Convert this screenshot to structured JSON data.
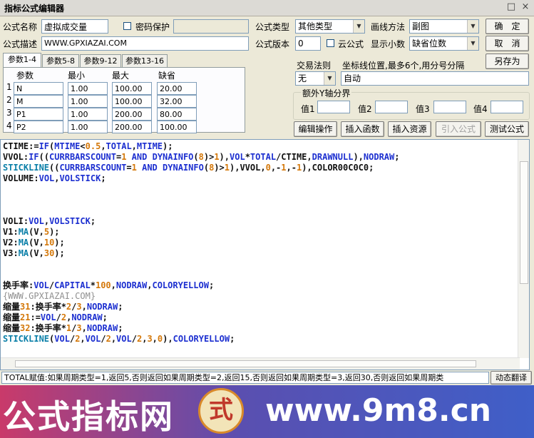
{
  "window": {
    "title": "指标公式编辑器",
    "close_glyph": "×",
    "restore_glyph": "□"
  },
  "form": {
    "name_label": "公式名称",
    "name_value": "虚拟成交量",
    "password_label": "密码保护",
    "desc_label": "公式描述",
    "desc_value": "WWW.GPXIAZAI.COM",
    "type_label": "公式类型",
    "type_value": "其他类型",
    "draw_label": "画线方法",
    "draw_value": "副图",
    "version_label": "公式版本",
    "version_value": "0",
    "cloud_label": "云公式",
    "decimal_label": "显示小数",
    "decimal_value": "缺省位数"
  },
  "buttons": {
    "ok": "确　定",
    "cancel": "取　消",
    "save_as": "另存为",
    "edit_ops": "编辑操作",
    "insert_fn": "插入函数",
    "insert_res": "插入资源",
    "import": "引入公式",
    "test": "测试公式",
    "dyn_translate": "动态翻译"
  },
  "tabs": [
    "参数1-4",
    "参数5-8",
    "参数9-12",
    "参数13-16"
  ],
  "params": {
    "headers": [
      "参数",
      "最小",
      "最大",
      "缺省"
    ],
    "rows": [
      {
        "idx": "1",
        "name": "N",
        "min": "1.00",
        "max": "100.00",
        "def": "20.00"
      },
      {
        "idx": "2",
        "name": "M",
        "min": "1.00",
        "max": "100.00",
        "def": "32.00"
      },
      {
        "idx": "3",
        "name": "P1",
        "min": "1.00",
        "max": "200.00",
        "def": "80.00"
      },
      {
        "idx": "4",
        "name": "P2",
        "min": "1.00",
        "max": "200.00",
        "def": "100.00"
      }
    ]
  },
  "trade": {
    "rule_label": "交易法则",
    "rule_value": "无",
    "axis_label": "坐标线位置,最多6个,用分号分隔",
    "axis_value": "自动"
  },
  "extra_axis": {
    "title": "额外Y轴分界",
    "labels": [
      "值1",
      "值2",
      "值3",
      "值4"
    ]
  },
  "code_lines": [
    "CTIME:=IF(MTIME<0.5,TOTAL,MTIME);",
    "VVOL:IF((CURRBARSCOUNT=1 AND DYNAINFO(8)>1),VOL*TOTAL/CTIME,DRAWNULL),NODRAW;",
    "STICKLINE((CURRBARSCOUNT=1 AND DYNAINFO(8)>1),VVOL,0,-1,-1),COLOR00C0C0;",
    "VOLUME:VOL,VOLSTICK;",
    "",
    "",
    "",
    "VOLI:VOL,VOLSTICK;",
    "V1:MA(V,5);",
    "V2:MA(V,10);",
    "V3:MA(V,30);",
    "",
    "",
    "换手率:VOL/CAPITAL*100,NODRAW,COLORYELLOW;",
    "{WWW.GPXIAZAI.COM}",
    "缩量31:换手率*2/3,NODRAW;",
    "缩量21:=VOL/2,NODRAW;",
    "缩量32:换手率*1/3,NODRAW;",
    "STICKLINE(VOL/2,VOL/2,VOL/2,3,0),COLORYELLOW;"
  ],
  "status_text": "TOTAL赋值:如果周期类型=1,返回5,否则返回如果周期类型=2,返回15,否则返回如果周期类型=3,返回30,否则返回如果周期类",
  "banner": {
    "left_text": "公式指标网",
    "right_text": "www.9m8.cn",
    "logo_char": "式"
  },
  "colors": {
    "keyword": "#1c2fd0",
    "function": "#0a7fa8",
    "number": "#d4780a",
    "text": "#101010",
    "comment": "#909090",
    "banner_text": "#ffffff"
  }
}
